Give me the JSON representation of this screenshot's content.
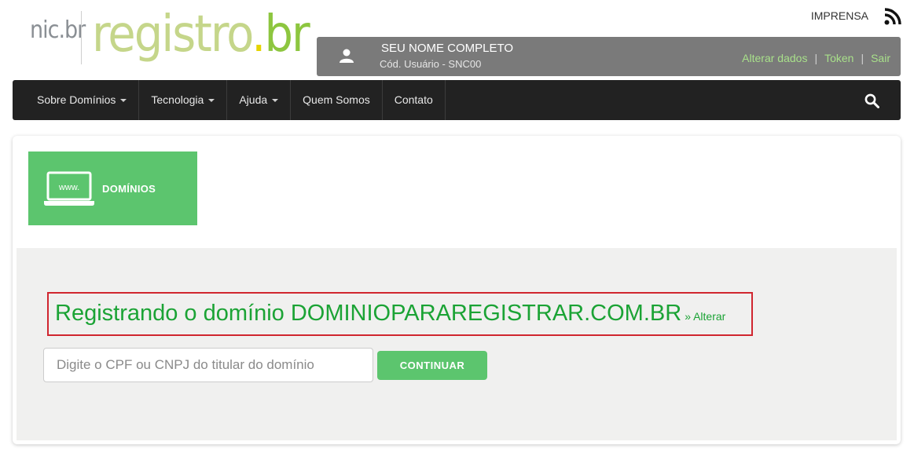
{
  "header": {
    "logo_nic": "nic.br",
    "logo_registro": "registro",
    "logo_dot": ".",
    "logo_br": "br",
    "imprensa": "IMPRENSA",
    "rss_icon": "rss-icon"
  },
  "user": {
    "name": "SEU NOME COMPLETO",
    "code": "Cód. Usuário - SNC00",
    "links": [
      "Alterar dados",
      "Token",
      "Sair"
    ]
  },
  "nav": {
    "items": [
      {
        "label": "Sobre Domínios",
        "dropdown": true
      },
      {
        "label": "Tecnologia",
        "dropdown": true
      },
      {
        "label": "Ajuda",
        "dropdown": true
      },
      {
        "label": "Quem Somos",
        "dropdown": false
      },
      {
        "label": "Contato",
        "dropdown": false
      }
    ],
    "search_icon": "search-icon"
  },
  "section": {
    "tile_label": "DOMÍNIOS",
    "tile_icon_text": "www.",
    "tile_color": "#5cc56e"
  },
  "registration": {
    "title": "Registrando o domínio DOMINIOPARAREGISTRAR.COM.BR",
    "alter_link": "» Alterar",
    "input_placeholder": "Digite o CPF ou CNPJ do titular do domínio",
    "input_value": "",
    "continue_label": "CONTINUAR"
  },
  "colors": {
    "accent_green": "#5cc56e",
    "title_green": "#1ba335",
    "highlight_red": "#d0262f",
    "navbar_bg": "#222222",
    "userbar_bg": "#7a7a7a"
  }
}
